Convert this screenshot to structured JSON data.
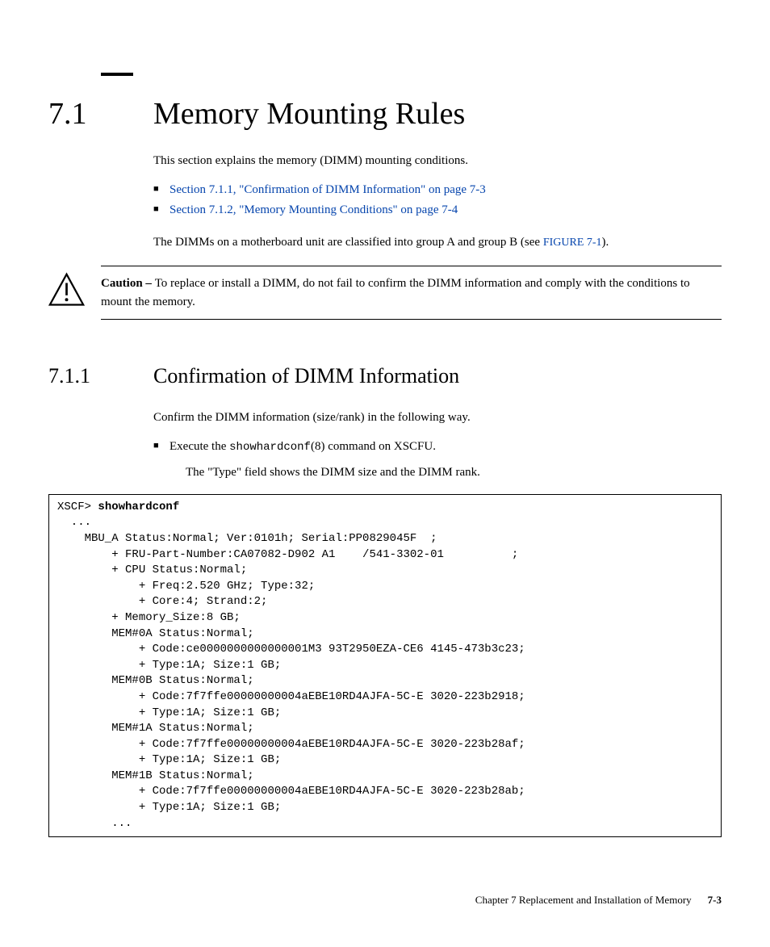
{
  "section": {
    "number": "7.1",
    "title": "Memory Mounting Rules",
    "intro": "This section explains the memory (DIMM) mounting conditions.",
    "links": [
      "Section 7.1.1, \"Confirmation of DIMM Information\" on page 7-3",
      "Section 7.1.2, \"Memory Mounting Conditions\" on page 7-4"
    ],
    "para2_pre": "The DIMMs on a motherboard unit are classified into group A and group B (see ",
    "figure_ref": "FIGURE 7-1",
    "para2_post": ")."
  },
  "caution": {
    "label": "Caution – ",
    "text": "To replace or install a DIMM, do not fail to confirm the DIMM information and comply with the conditions to mount the memory."
  },
  "subsection": {
    "number": "7.1.1",
    "title": "Confirmation of DIMM Information",
    "intro": "Confirm the DIMM information (size/rank) in the following way.",
    "bullet_pre": "Execute the ",
    "bullet_cmd": "showhardconf",
    "bullet_post": "(8) command on XSCFU.",
    "sub_para": "The \"Type\" field shows the DIMM size and the DIMM rank."
  },
  "code": {
    "prompt": "XSCF> ",
    "command": "showhardconf",
    "body": "  ...\n    MBU_A Status:Normal; Ver:0101h; Serial:PP0829045F  ;\n        + FRU-Part-Number:CA07082-D902 A1    /541-3302-01          ;\n        + CPU Status:Normal;\n            + Freq:2.520 GHz; Type:32;\n            + Core:4; Strand:2;\n        + Memory_Size:8 GB;\n        MEM#0A Status:Normal;\n            + Code:ce0000000000000001M3 93T2950EZA-CE6 4145-473b3c23;\n            + Type:1A; Size:1 GB;\n        MEM#0B Status:Normal;\n            + Code:7f7ffe00000000004aEBE10RD4AJFA-5C-E 3020-223b2918;\n            + Type:1A; Size:1 GB;\n        MEM#1A Status:Normal;\n            + Code:7f7ffe00000000004aEBE10RD4AJFA-5C-E 3020-223b28af;\n            + Type:1A; Size:1 GB;\n        MEM#1B Status:Normal;\n            + Code:7f7ffe00000000004aEBE10RD4AJFA-5C-E 3020-223b28ab;\n            + Type:1A; Size:1 GB;\n        ..."
  },
  "footer": {
    "chapter": "Chapter 7    Replacement and Installation of Memory",
    "page": "7-3"
  }
}
